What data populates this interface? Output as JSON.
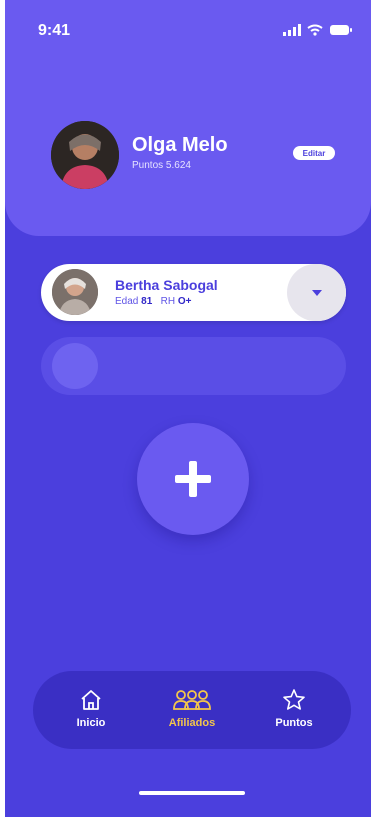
{
  "status_bar": {
    "time": "9:41"
  },
  "profile": {
    "name": "Olga Melo",
    "points": "Puntos 5.624",
    "edit_label": "Editar"
  },
  "affiliate": {
    "name": "Bertha Sabogal",
    "age_label": "Edad",
    "age": "81",
    "rh_label": "RH",
    "rh": "O+"
  },
  "tabs": [
    {
      "label": "Inicio",
      "icon": "home-icon",
      "active": false
    },
    {
      "label": "Afiliados",
      "icon": "people-icon",
      "active": true
    },
    {
      "label": "Puntos",
      "icon": "star-icon",
      "active": false
    }
  ],
  "colors": {
    "background": "#4B3FDD",
    "card": "#6A5AF0",
    "accent": "#F3C64B",
    "tabbar": "#3A2FC4"
  }
}
